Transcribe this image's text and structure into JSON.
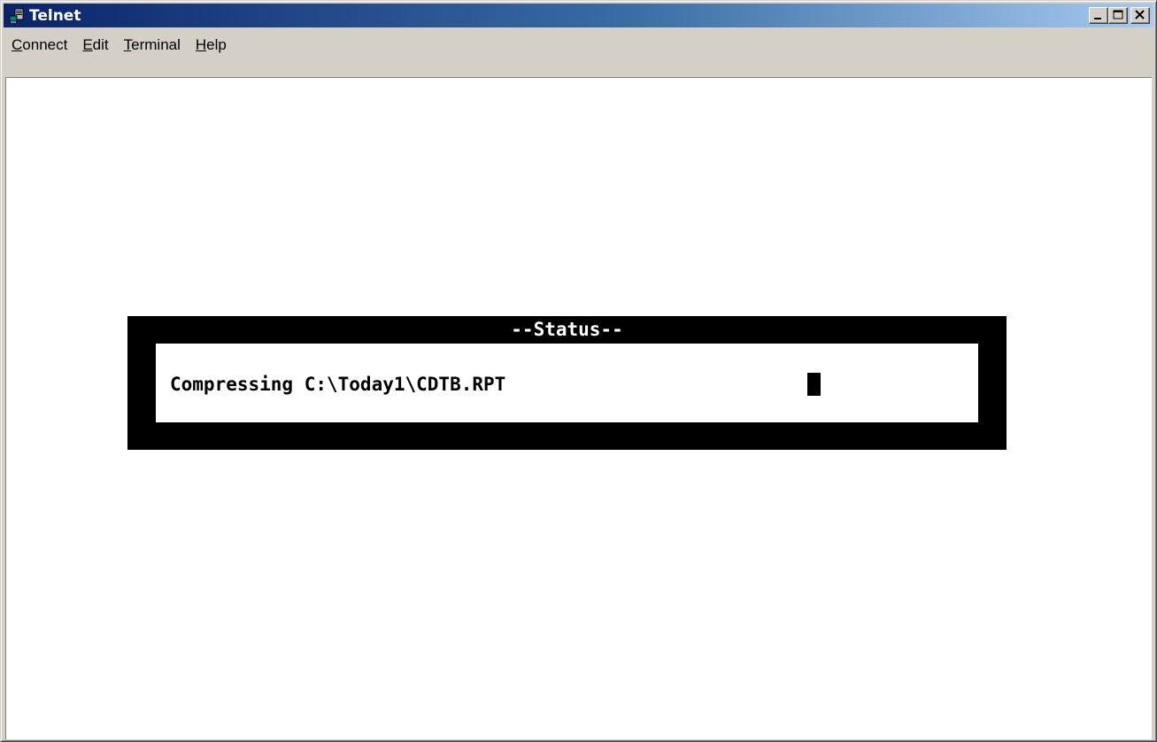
{
  "window": {
    "title": "Telnet",
    "icon": "telnet-app-icon",
    "controls": [
      "minimize-icon",
      "maximize-icon",
      "close-icon"
    ]
  },
  "menubar": {
    "items": [
      {
        "label": "Connect",
        "accel": "C",
        "rest": "onnect"
      },
      {
        "label": "Edit",
        "accel": "E",
        "rest": "dit"
      },
      {
        "label": "Terminal",
        "accel": "T",
        "rest": "erminal"
      },
      {
        "label": "Help",
        "accel": "H",
        "rest": "elp"
      }
    ]
  },
  "terminal": {
    "status_title": "--Status--",
    "status_message": "Compressing C:\\Today1\\CDTB.RPT"
  },
  "colors": {
    "titlebar_start": "#0a246a",
    "titlebar_end": "#a6caf0",
    "frame": "#d4d0c8",
    "terminal_bg": "#ffffff",
    "dialog_border": "#000000"
  }
}
